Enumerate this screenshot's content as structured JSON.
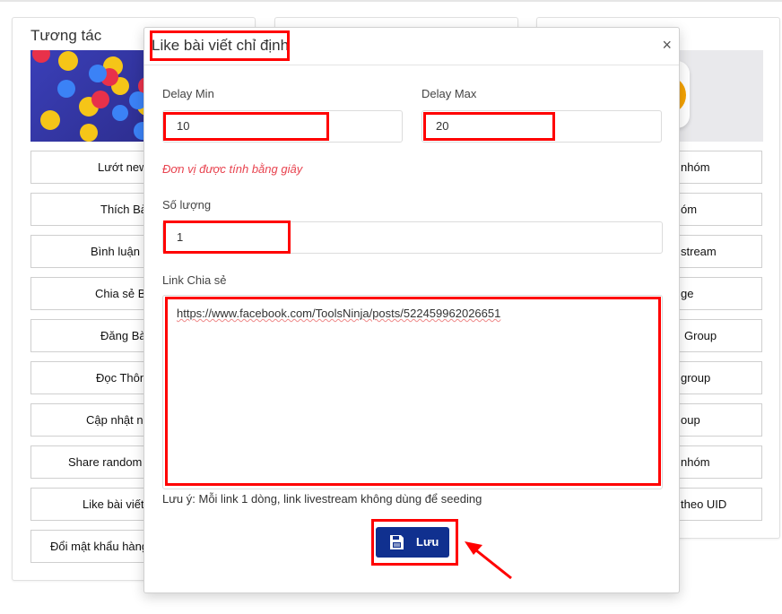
{
  "left_card": {
    "title": "Tương tác",
    "buttons": [
      "Lướt new",
      "Thích Bà",
      "Bình luận B",
      "Chia sẻ B",
      "Đăng Bà",
      "Đọc Thôn",
      "Cập nhật ng",
      "Share random",
      "Like bài viết",
      "Đổi mật khẩu hàng"
    ]
  },
  "right_card": {
    "buttons": [
      "nhóm",
      "óm",
      "stream",
      "ge",
      "Group",
      "group",
      "oup",
      "nhóm",
      "theo UID"
    ]
  },
  "modal": {
    "title": "Like bài viết chỉ định",
    "close_label": "×",
    "delay_min_label": "Delay Min",
    "delay_min_value": "10",
    "delay_max_label": "Delay Max",
    "delay_max_value": "20",
    "unit_hint": "Đơn vị được tính bằng giây",
    "quantity_label": "Số lượng",
    "quantity_value": "1",
    "link_label": "Link Chia sẻ",
    "link_value": "https://www.facebook.com/ToolsNinja/posts/522459962026651",
    "note": "Lưu ý: Mỗi link 1 dòng, link livestream không dùng để seeding",
    "save_label": "Lưu"
  },
  "colors": {
    "highlight": "#ff0000",
    "primary": "#10308f",
    "hint": "#e8434f"
  }
}
